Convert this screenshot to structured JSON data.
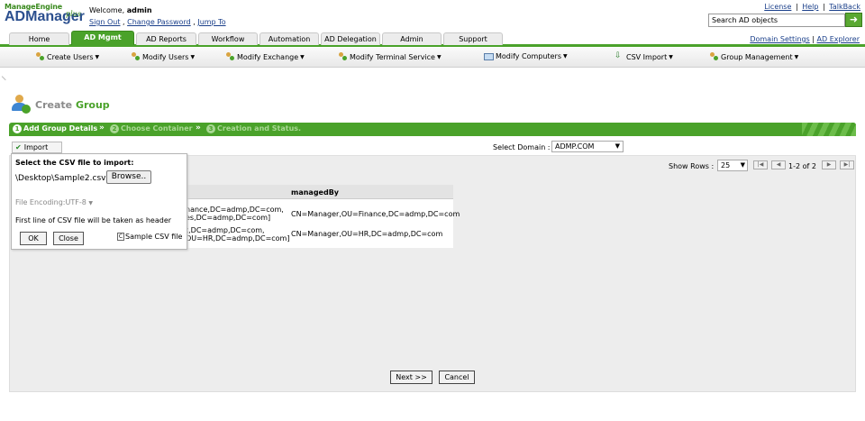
{
  "header": {
    "brand_top": "ManageEngine",
    "brand_main": "ADManager",
    "brand_plus": "plus",
    "welcome_label": "Welcome,",
    "username": "admin",
    "sign_out": "Sign Out",
    "sep_comma": ",",
    "change_password": "Change Password",
    "jump_to": "Jump To",
    "links": [
      "License",
      "Help",
      "TalkBack"
    ],
    "link_sep": "|",
    "search_placeholder": "Search AD objects",
    "search_go": "➜"
  },
  "tabs": [
    {
      "label": "Home",
      "active": false
    },
    {
      "label": "AD Mgmt",
      "active": true
    },
    {
      "label": "AD Reports",
      "active": false
    },
    {
      "label": "Workflow",
      "active": false
    },
    {
      "label": "Automation",
      "active": false
    },
    {
      "label": "AD Delegation",
      "active": false
    },
    {
      "label": "Admin",
      "active": false
    },
    {
      "label": "Support",
      "active": false
    }
  ],
  "right_links": {
    "domain_settings": "Domain Settings",
    "sep": "|",
    "ad_explorer": "AD Explorer"
  },
  "submenu": [
    {
      "label": "Create Users",
      "icon": "users-icon"
    },
    {
      "label": "Modify Users",
      "icon": "users-icon"
    },
    {
      "label": "Modify Exchange",
      "icon": "exchange-icon"
    },
    {
      "label": "Modify Terminal Service",
      "icon": "terminal-service-icon"
    },
    {
      "label": "Modify Computers",
      "icon": "computer-icon"
    },
    {
      "label": "CSV Import",
      "icon": "csv-icon"
    },
    {
      "label": "Group Management",
      "icon": "group-icon"
    }
  ],
  "page": {
    "title_plain": "Create ",
    "title_highlight": "Group"
  },
  "wizard": {
    "steps": [
      {
        "num": "1",
        "label": "Add Group Details",
        "active": true
      },
      {
        "num": "2",
        "label": "Choose Container",
        "active": false
      },
      {
        "num": "3",
        "label": "Creation and Status.",
        "active": false
      }
    ],
    "separator": "»"
  },
  "toolbar": {
    "import_label": "Import",
    "domain_label": "Select Domain :",
    "domain_value": "ADMP.COM"
  },
  "pagination": {
    "show_rows_label": "Show Rows :",
    "rows_value": "25",
    "range_text": "1-2 of 2"
  },
  "table": {
    "visible_header": "managedBy",
    "rows": [
      {
        "partial_line1": "nance,DC=admp,DC=com,",
        "partial_line2": "es,DC=admp,DC=com]",
        "managedBy": "CN=Manager,OU=Finance,DC=admp,DC=com"
      },
      {
        "partial_line1": "t,DC=admp,DC=com,",
        "partial_line2": "OU=HR,DC=admp,DC=com]",
        "managedBy": "CN=Manager,OU=HR,DC=admp,DC=com"
      }
    ]
  },
  "import_panel": {
    "title": "Select the CSV file to import:",
    "file_path": "\\Desktop\\Sample2.csv",
    "browse_label": "Browse..",
    "encoding_label": "File Encoding:UTF-8",
    "note": "First line of CSV file will be taken as header",
    "ok_label": "OK",
    "close_label": "Close",
    "sample_label": "Sample CSV file"
  },
  "footer": {
    "next_label": "Next >>",
    "cancel_label": "Cancel"
  },
  "colors": {
    "accent_green": "#4aa22a",
    "link_blue": "#1a3f8a",
    "brand_blue": "#2b4f8e"
  }
}
